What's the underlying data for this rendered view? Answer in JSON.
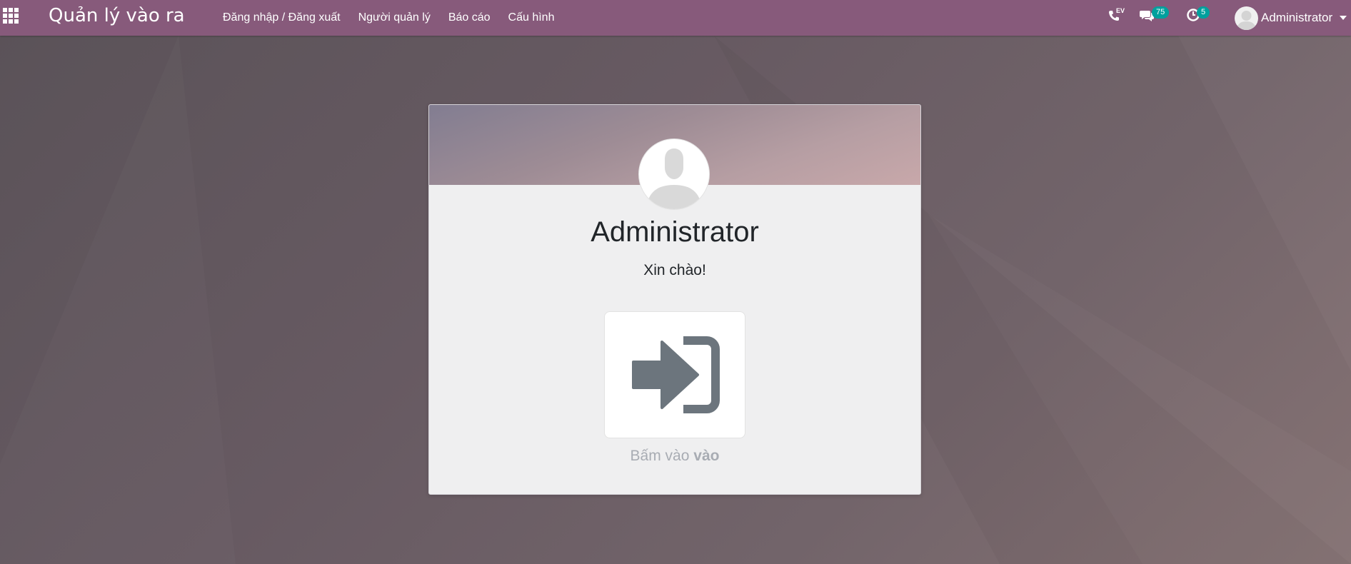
{
  "app": {
    "title": "Quản lý vào ra",
    "menu": [
      {
        "label": "Đăng nhập / Đăng xuất"
      },
      {
        "label": "Người quản lý"
      },
      {
        "label": "Báo cáo"
      },
      {
        "label": "Cấu hình"
      }
    ]
  },
  "systray": {
    "voip_label": "EV",
    "messages_count": "75",
    "activities_count": "5",
    "user_name": "Administrator"
  },
  "card": {
    "employee_name": "Administrator",
    "greeting": "Xin chào!",
    "hint_prefix": "Bấm vào",
    "hint_action": "vào"
  },
  "colors": {
    "navbar": "#875a7b",
    "badge": "#00a09d",
    "icon_gray": "#6c757d"
  }
}
